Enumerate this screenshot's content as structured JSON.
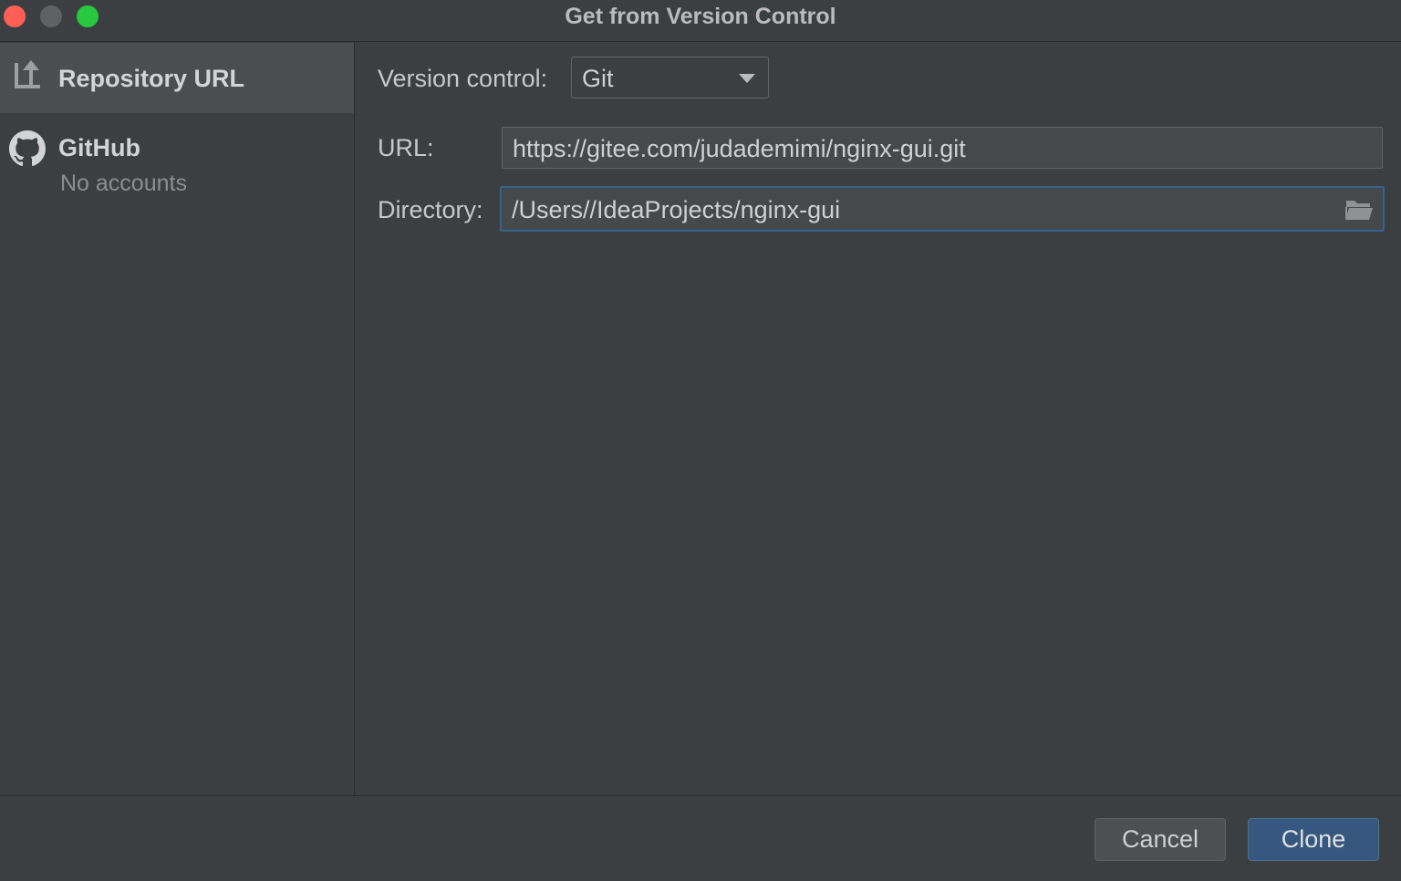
{
  "window": {
    "title": "Get from Version Control"
  },
  "sidebar": {
    "items": [
      {
        "label": "Repository URL",
        "icon": "repository-url-icon",
        "selected": true
      },
      {
        "label": "GitHub",
        "sublabel": "No accounts",
        "icon": "github-icon",
        "selected": false
      }
    ]
  },
  "form": {
    "version_control": {
      "label": "Version control:",
      "value": "Git"
    },
    "url": {
      "label": "URL:",
      "value": "https://gitee.com/judademimi/nginx-gui.git"
    },
    "directory": {
      "label": "Directory:",
      "value": "/Users//IdeaProjects/nginx-gui",
      "icon": "folder-open-icon"
    }
  },
  "footer": {
    "cancel_label": "Cancel",
    "clone_label": "Clone"
  },
  "colors": {
    "background": "#3c3f41",
    "selected_item": "#4b4e50",
    "focus_border": "#3d6185",
    "primary_button": "#365880"
  }
}
